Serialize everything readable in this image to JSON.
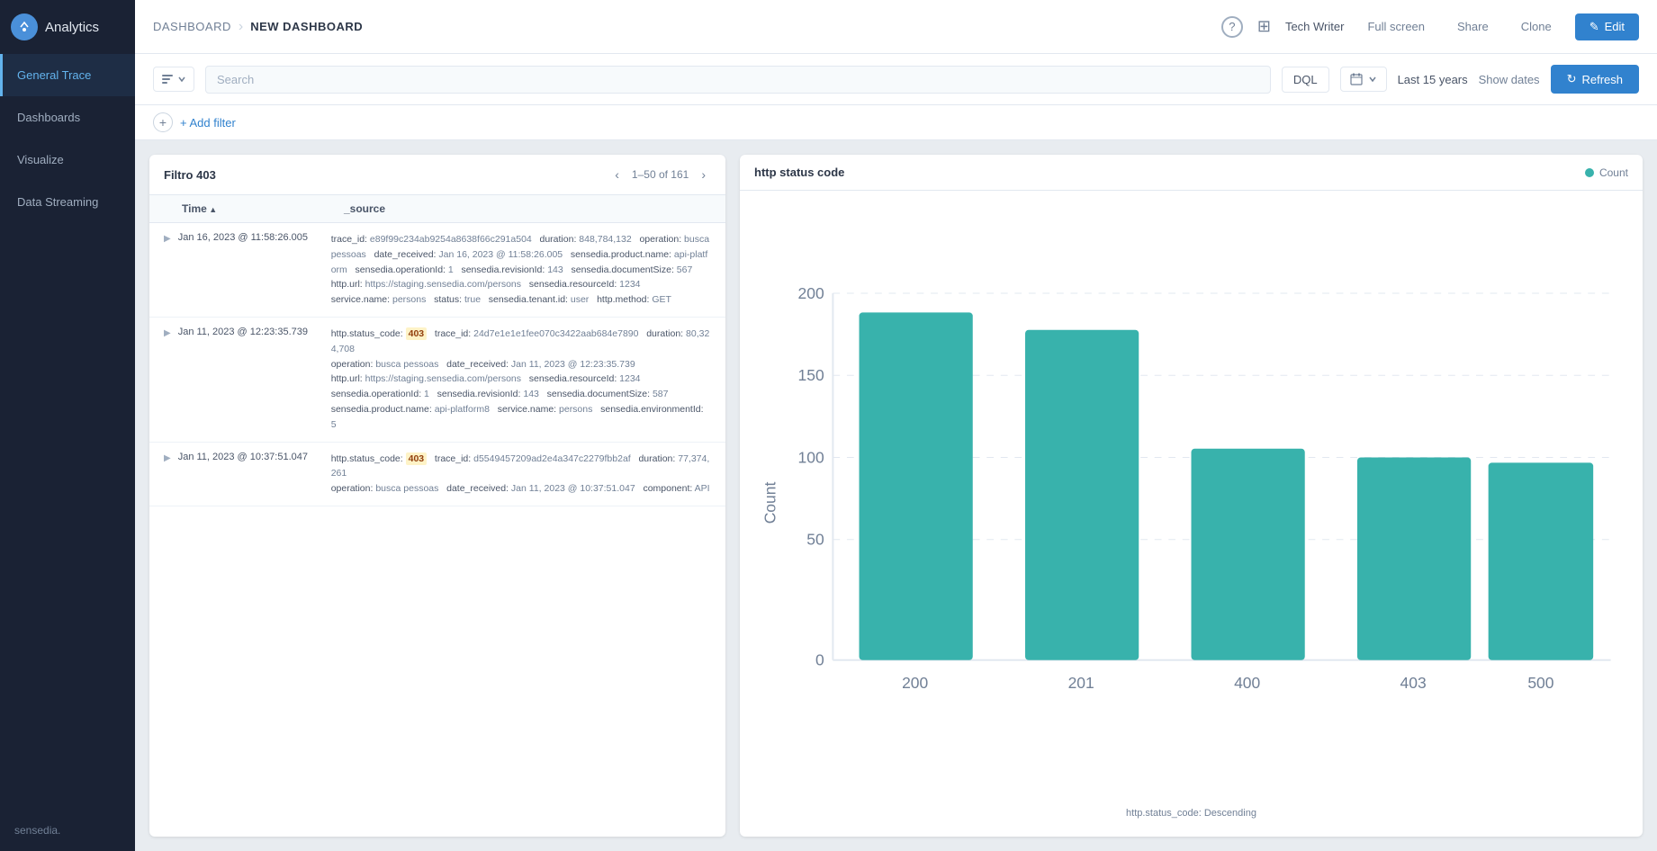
{
  "sidebar": {
    "logo": {
      "icon": "A",
      "text": "Analytics"
    },
    "items": [
      {
        "id": "general-trace",
        "label": "General Trace",
        "active": true
      },
      {
        "id": "dashboards",
        "label": "Dashboards",
        "active": false
      },
      {
        "id": "visualize",
        "label": "Visualize",
        "active": false
      },
      {
        "id": "data-streaming",
        "label": "Data Streaming",
        "active": false
      }
    ],
    "footer_logo": "sensedia."
  },
  "topbar": {
    "breadcrumb_parent": "DASHBOARD",
    "breadcrumb_separator": "›",
    "breadcrumb_current": "NEW DASHBOARD",
    "actions": {
      "fullscreen": "Full screen",
      "share": "Share",
      "clone": "Clone",
      "edit_icon": "✎",
      "edit": "Edit"
    },
    "help_icon": "?",
    "grid_icon": "⊞",
    "user": "Tech Writer"
  },
  "filterbar": {
    "search_placeholder": "Search",
    "dql_label": "DQL",
    "time_range": "Last 15 years",
    "show_dates": "Show dates",
    "refresh_icon": "↻",
    "refresh": "Refresh",
    "add_filter": "+ Add filter"
  },
  "table_panel": {
    "title": "Filtro 403",
    "pagination": "1–50 of 161",
    "col_time": "Time",
    "col_source": "_source",
    "rows": [
      {
        "time": "Jan 16, 2023 @ 11:58:26.005",
        "source": "trace_id:  e89f99c234ab9254a8638f66c291a504  duration:  848,784,132  operation:  busca pessoas  date_received:  Jan 16, 2023 @ 11:58:26.005  sensedia.product.name:  api-platform  sensedia.operationId:  1  sensedia.revisionId:  143  sensedia.documentSize:  567  http.url:  https://staging.sensedia.com/persons  sensedia.resourceId:  1234  service.name:  persons  status:  true  sensedia.tenant.id:  user  http.method:  GET",
        "has_403": false
      },
      {
        "time": "Jan 11, 2023 @ 12:23:35.739",
        "source": "http.status_code:  403  trace_id:  24d7e1e1e1fee070c3422aab684e7890  duration:  80,324,708  operation:  busca pessoas  date_received:  Jan 11, 2023 @ 12:23:35.739  http.url:  https://staging.sensedia.com/persons  sensedia.resourceId:  1234  sensedia.operationId:  1  sensedia.revisionId:  143  sensedia.documentSize:  587  sensedia.product.name:  api-platform8  service.name:  persons  sensedia.environmentId:  5",
        "has_403": true
      },
      {
        "time": "Jan 11, 2023 @ 10:37:51.047",
        "source": "http.status_code:  403  trace_id:  d5549457209ad2e4a347c2279fbb2af  duration:  77,374,261  operation:  busca pessoas  date_received:  Jan 11, 2023 @ 10:37:51.047  component:  API",
        "has_403": true
      }
    ]
  },
  "chart_panel": {
    "title": "http status code",
    "legend_label": "Count",
    "footer_label": "http.status_code: Descending",
    "bars": [
      {
        "label": "200",
        "value": 190,
        "height_pct": 95
      },
      {
        "label": "201",
        "value": 180,
        "height_pct": 90
      },
      {
        "label": "400",
        "value": 115,
        "height_pct": 57
      },
      {
        "label": "403",
        "value": 110,
        "height_pct": 55
      },
      {
        "label": "500",
        "value": 108,
        "height_pct": 54
      }
    ],
    "y_labels": [
      "200",
      "150",
      "100",
      "50",
      "0"
    ],
    "y_axis_label": "Count"
  }
}
